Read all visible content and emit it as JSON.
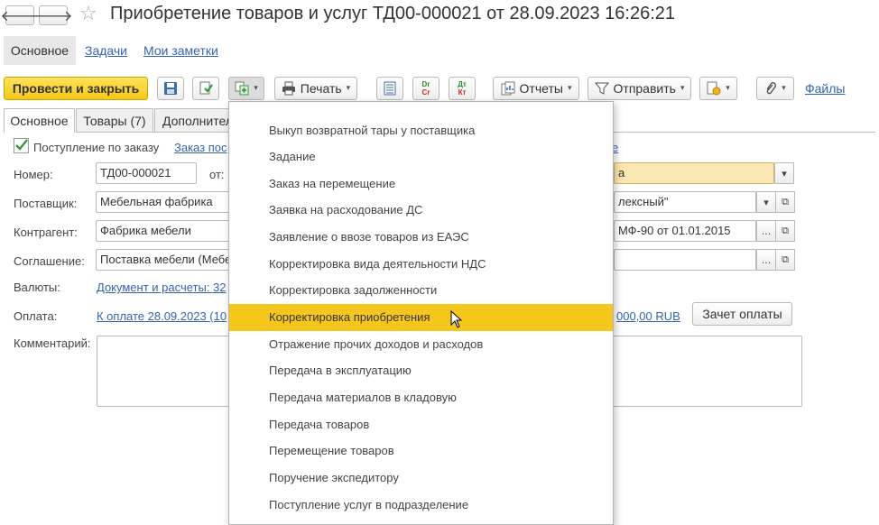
{
  "window": {
    "title": "Приобретение товаров и услуг ТД00-000021 от 28.09.2023 16:26:21",
    "back_glyph": "🡐",
    "forward_glyph": "🡒",
    "star_glyph": "☆"
  },
  "topnav": {
    "main": "Основное",
    "tasks": "Задачи",
    "notes": "Мои заметки"
  },
  "toolbar": {
    "post_close": "Провести и закрыть",
    "print": "Печать",
    "reports": "Отчеты",
    "send": "Отправить",
    "files": "Файлы",
    "dt_top": "Dr",
    "dt_bottom": "Cr",
    "kt_top": "Дт",
    "kt_bottom": "Кт"
  },
  "tabs": {
    "main": "Основное",
    "goods": "Товары (7)",
    "extra": "Дополнител"
  },
  "form": {
    "by_order_label": "Поступление по заказу",
    "order_link": "Заказ пос",
    "right_link_fragment": "е",
    "number_label": "Номер:",
    "number_value": "ТД00-000021",
    "from_label": "от:",
    "supplier_label": "Поставщик:",
    "supplier_value": "Мебельная фабрика",
    "right_org_value": "а",
    "right_supplier_value": "лексный\"",
    "contractor_label": "Контрагент:",
    "contractor_value": "Фабрика мебели",
    "contract_value": "МФ-90 от 01.01.2015",
    "agreement_label": "Соглашение:",
    "agreement_value": "Поставка мебели (Мебе",
    "currency_label": "Валюты:",
    "currency_link": "Документ и расчеты: 32",
    "payment_label": "Оплата:",
    "payment_link": "К оплате 28.09.2023 (10",
    "payment_right_link": "000,00 RUB",
    "offset_button": "Зачет оплаты",
    "comment_label": "Комментарий:",
    "ellipsis": "...",
    "open_glyph": "⧉",
    "caret_glyph": "▾"
  },
  "dropdown": {
    "items": [
      "Выкуп возвратной тары у поставщика",
      "Задание",
      "Заказ на перемещение",
      "Заявка на расходование ДС",
      "Заявление о ввозе товаров из ЕАЭС",
      "Корректировка вида деятельности НДС",
      "Корректировка задолженности",
      "Корректировка приобретения",
      "Отражение прочих доходов и расходов",
      "Передача в эксплуатацию",
      "Передача материалов в кладовую",
      "Передача товаров",
      "Перемещение товаров",
      "Поручение экспедитору",
      "Поступление услуг в подразделение"
    ],
    "highlighted_index": 7,
    "highlight_color": "#f5c71d"
  }
}
